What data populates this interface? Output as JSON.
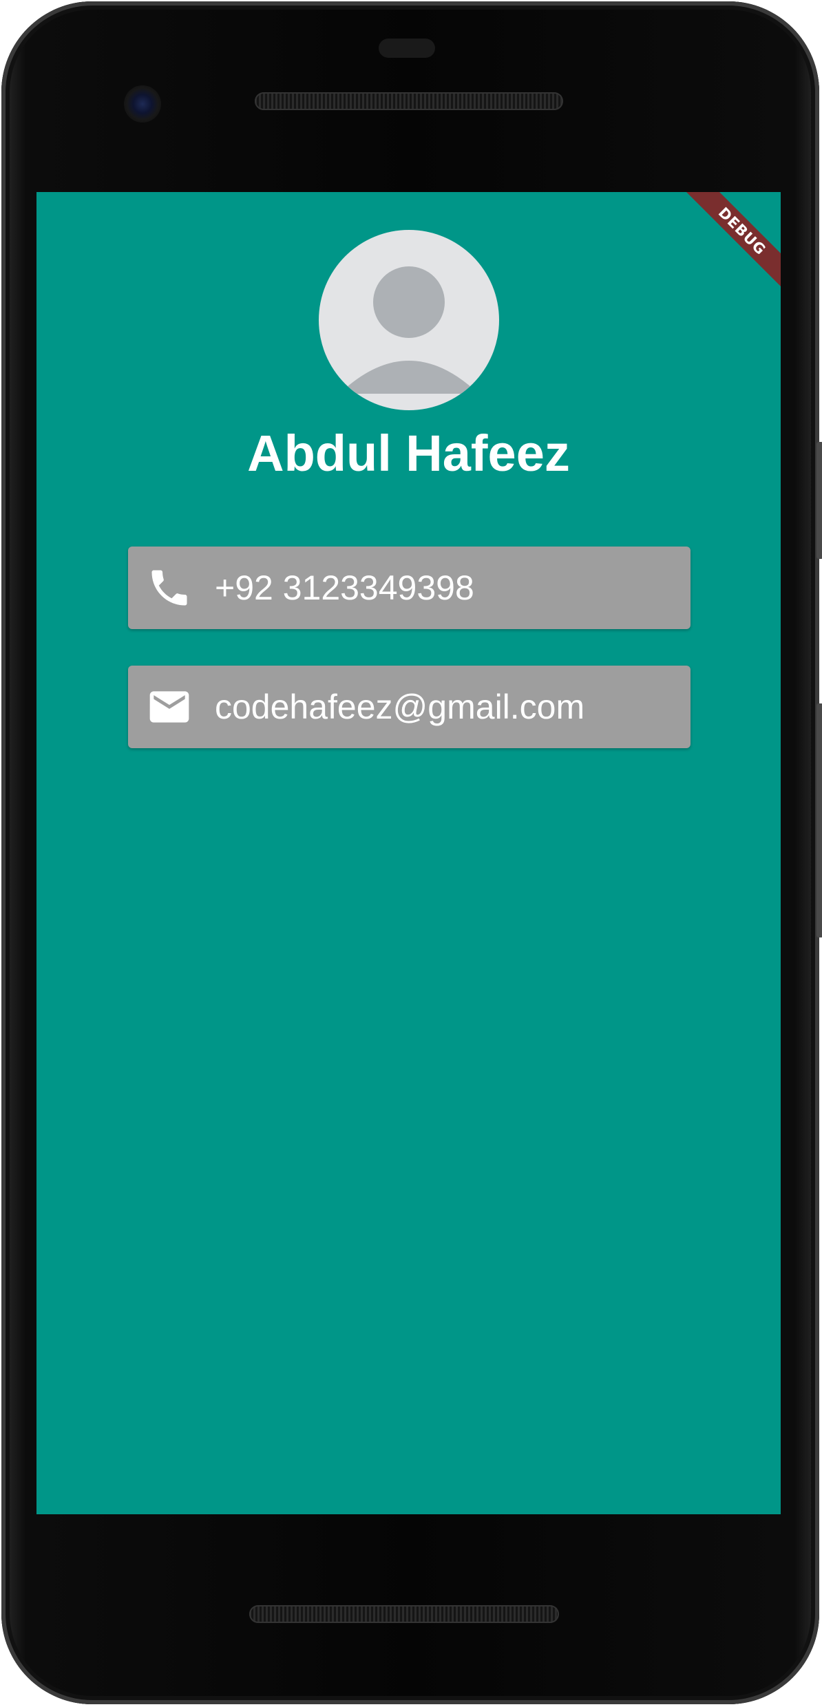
{
  "app": {
    "background_color": "#009688",
    "debug_banner": "DEBUG"
  },
  "profile": {
    "avatar_icon": "default-user-avatar",
    "name": "Abdul Hafeez"
  },
  "contacts": {
    "phone": {
      "icon": "phone-icon",
      "value": "+92 3123349398"
    },
    "email": {
      "icon": "mail-icon",
      "value": "codehafeez@gmail.com"
    },
    "card_color": "#9e9e9e"
  }
}
